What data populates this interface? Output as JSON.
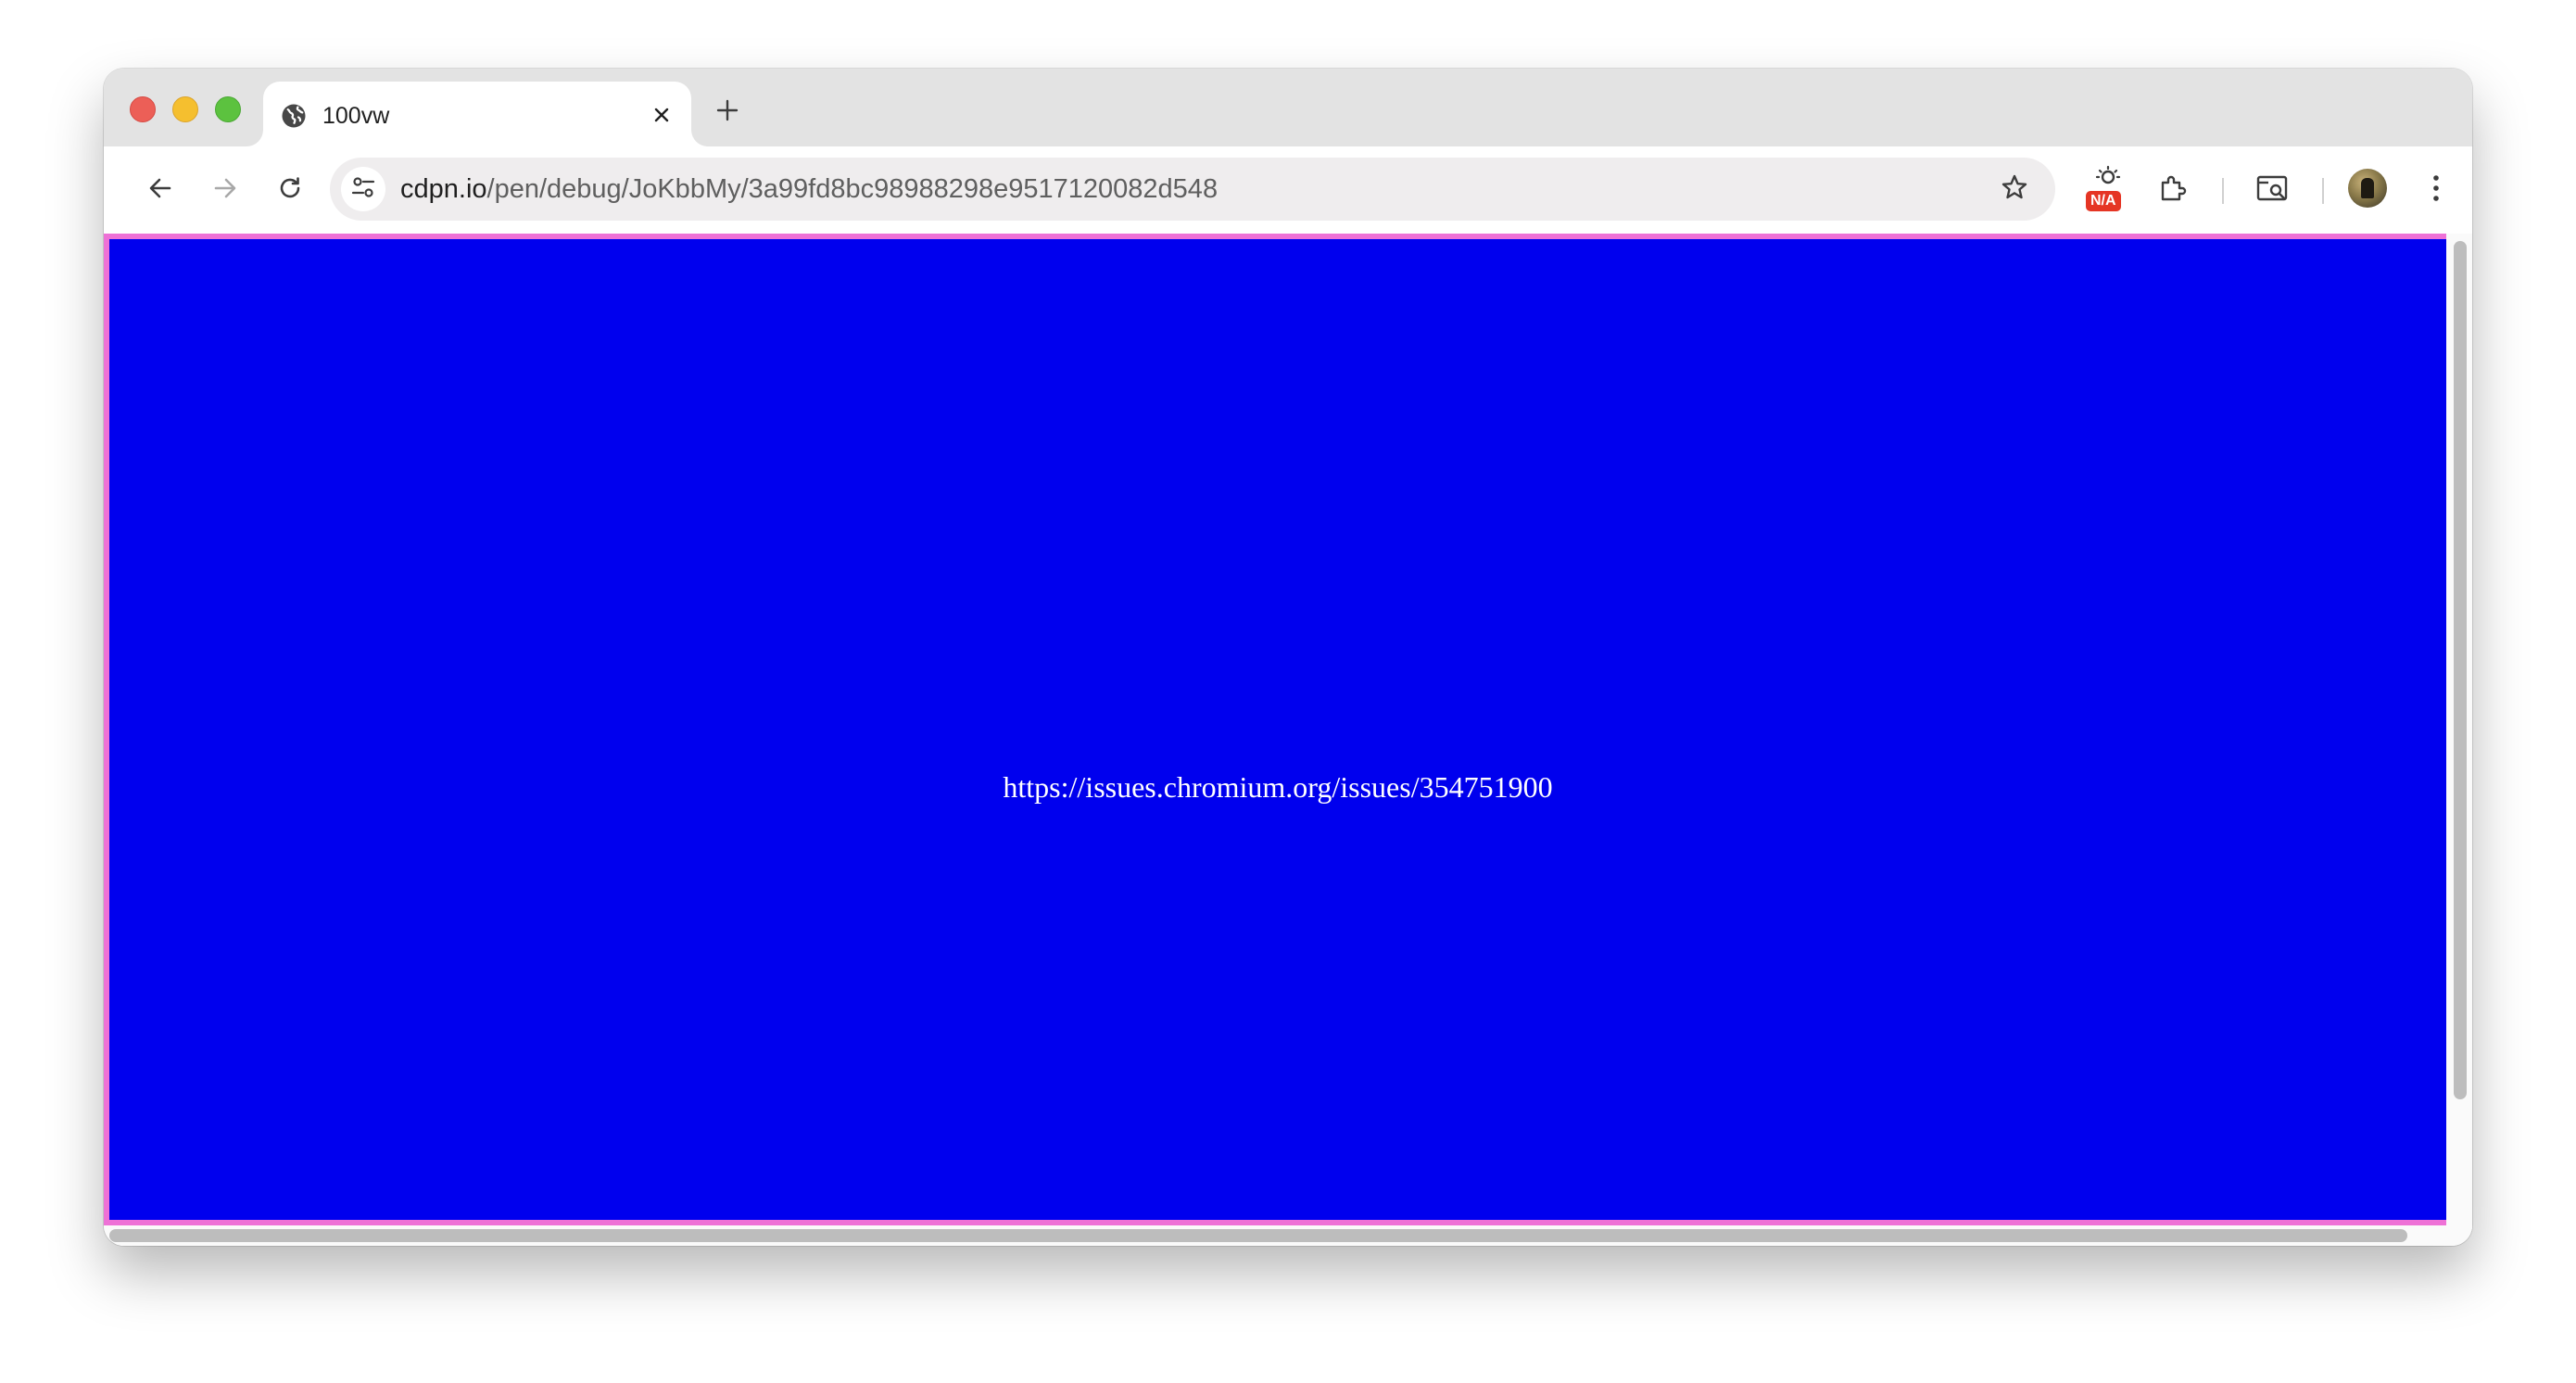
{
  "tab": {
    "title": "100vw",
    "favicon": "globe-icon",
    "close_icon": "close-icon"
  },
  "new_tab_icon": "plus-icon",
  "toolbar": {
    "back_icon": "arrow-left-icon",
    "forward_icon": "arrow-right-icon",
    "reload_icon": "reload-icon",
    "site_info_icon": "tune-icon",
    "url_host": "cdpn.io",
    "url_path": "/pen/debug/JoKbbMy/3a99fd8bc98988298e9517120082d548",
    "bookmark_icon": "star-icon",
    "extension_badge_text": "N/A",
    "extensions_icon": "puzzle-icon",
    "reading_mode_icon": "search-tab-icon",
    "menu_icon": "kebab-menu-icon"
  },
  "page": {
    "link_text": "https://issues.chromium.org/issues/354751900",
    "frame_color": "#ee71d6",
    "box_color": "#0000ee",
    "text_color": "#ffffff"
  },
  "colors": {
    "traffic_close": "#ec5f57",
    "traffic_minimize": "#f5bf2f",
    "traffic_maximize": "#5cc23f",
    "badge": "#e53524"
  }
}
